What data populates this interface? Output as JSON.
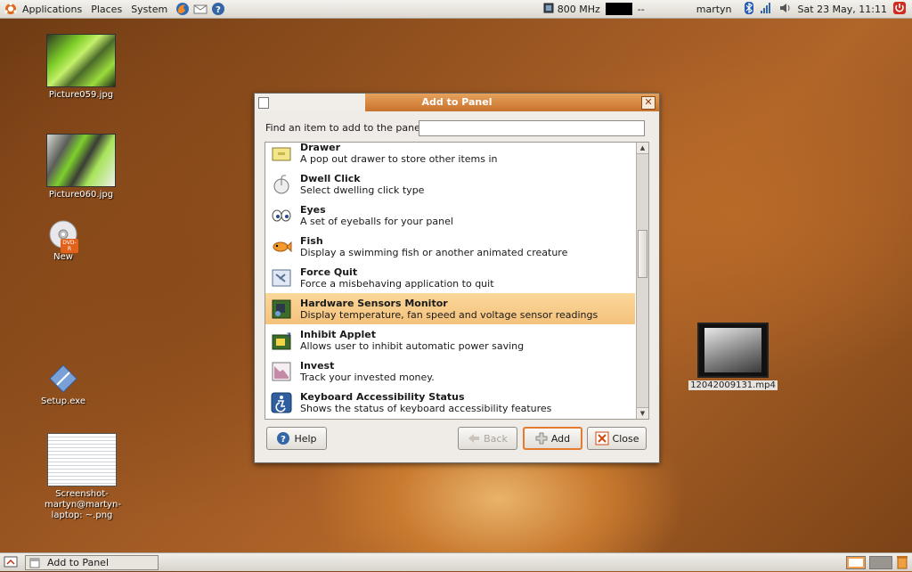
{
  "top_panel": {
    "menus": [
      "Applications",
      "Places",
      "System"
    ],
    "cpu_freq": "800 MHz",
    "cpu_sep": "--",
    "user": "martyn",
    "clock": "Sat 23 May, 11:11"
  },
  "desktop": {
    "icons": [
      {
        "label": "Picture059.jpg"
      },
      {
        "label": "Picture060.jpg"
      },
      {
        "label": "New",
        "badge": "DVD-R"
      },
      {
        "label": "Setup.exe"
      },
      {
        "label": "Screenshot-martyn@martyn-laptop: ~.png"
      },
      {
        "label": "12042009131.mp4"
      }
    ]
  },
  "dialog": {
    "title": "Add to Panel",
    "find_label": "Find an item to add to the panel:",
    "find_value": "",
    "items": [
      {
        "title": "Drawer",
        "desc": "A pop out drawer to store other items in",
        "icon": "drawer-icon"
      },
      {
        "title": "Dwell Click",
        "desc": "Select dwelling click type",
        "icon": "mouse-icon"
      },
      {
        "title": "Eyes",
        "desc": "A set of eyeballs for your panel",
        "icon": "eyes-icon"
      },
      {
        "title": "Fish",
        "desc": "Display a swimming fish or another animated creature",
        "icon": "fish-icon"
      },
      {
        "title": "Force Quit",
        "desc": "Force a misbehaving application to quit",
        "icon": "force-quit-icon"
      },
      {
        "title": "Hardware Sensors Monitor",
        "desc": "Display temperature, fan speed and voltage sensor readings",
        "icon": "sensor-chip-icon"
      },
      {
        "title": "Inhibit Applet",
        "desc": "Allows user to inhibit automatic power saving",
        "icon": "inhibit-icon"
      },
      {
        "title": "Invest",
        "desc": "Track your invested money.",
        "icon": "invest-chart-icon"
      },
      {
        "title": "Keyboard Accessibility Status",
        "desc": "Shows the status of keyboard accessibility features",
        "icon": "accessibility-icon"
      }
    ],
    "selected_index": 5,
    "buttons": {
      "help": "Help",
      "back": "Back",
      "add": "Add",
      "close": "Close"
    }
  },
  "bottom_panel": {
    "task_label": "Add to Panel"
  }
}
